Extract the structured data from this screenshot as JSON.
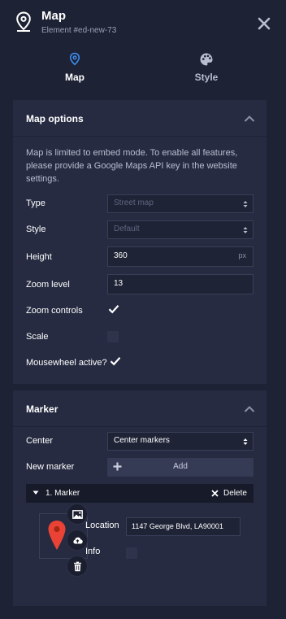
{
  "header": {
    "title": "Map",
    "subtitle": "Element #ed-new-73",
    "icon": "map-pin-icon",
    "close_icon": "close-icon"
  },
  "tabs": [
    {
      "label": "Map",
      "icon": "map-pin-icon",
      "active": true
    },
    {
      "label": "Style",
      "icon": "palette-icon",
      "active": false
    }
  ],
  "map_options": {
    "title": "Map options",
    "notice": "Map is limited to embed mode. To enable all features, please provide a Google Maps API key in the website settings.",
    "type": {
      "label": "Type",
      "value": "Street map"
    },
    "style": {
      "label": "Style",
      "value": "Default"
    },
    "height": {
      "label": "Height",
      "value": "360",
      "unit": "px"
    },
    "zoom_level": {
      "label": "Zoom level",
      "value": "13"
    },
    "zoom_controls": {
      "label": "Zoom controls",
      "checked": true
    },
    "scale": {
      "label": "Scale",
      "checked": false
    },
    "mousewheel": {
      "label": "Mousewheel active?",
      "checked": true
    }
  },
  "marker": {
    "title": "Marker",
    "center": {
      "label": "Center",
      "value": "Center markers"
    },
    "new_marker": {
      "label": "New marker",
      "button_label": "Add"
    },
    "items": [
      {
        "name": "1. Marker",
        "delete_label": "Delete",
        "location_label": "Location",
        "location_value": "1147 George Blvd, LA90001",
        "info_label": "Info",
        "info_checked": false
      }
    ]
  },
  "colors": {
    "background": "#1e2235",
    "panel": "#262b41",
    "accent": "#3d8ef0",
    "marker_pin": "#ea4335"
  }
}
